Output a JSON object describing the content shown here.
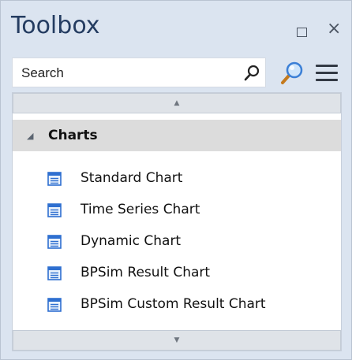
{
  "window": {
    "title": "Toolbox"
  },
  "search": {
    "placeholder": "Search"
  },
  "group": {
    "label": "Charts",
    "expanded": true
  },
  "items": [
    {
      "label": "Standard Chart",
      "icon": "chart-element-icon"
    },
    {
      "label": "Time Series Chart",
      "icon": "chart-element-icon"
    },
    {
      "label": "Dynamic Chart",
      "icon": "chart-element-icon"
    },
    {
      "label": "BPSim Result Chart",
      "icon": "chart-element-icon"
    },
    {
      "label": "BPSim Custom Result Chart",
      "icon": "chart-element-icon"
    }
  ],
  "colors": {
    "panel_bg": "#dbe4f0",
    "title": "#243c61",
    "group_bg": "#dcdcdc",
    "icon_blue": "#2e6fd0"
  }
}
